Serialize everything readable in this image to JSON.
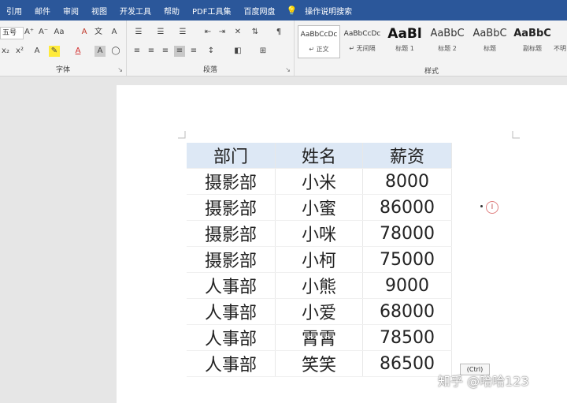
{
  "menubar": {
    "items": [
      "引用",
      "邮件",
      "审阅",
      "视图",
      "开发工具",
      "帮助",
      "PDF工具集",
      "百度网盘"
    ],
    "tell_me": "操作说明搜索"
  },
  "ribbon": {
    "font_group": {
      "label": "字体",
      "font_size": "五号"
    },
    "paragraph_group": {
      "label": "段落"
    },
    "styles_group": {
      "label": "样式",
      "items": [
        {
          "preview": "AaBbCcDc",
          "name": "↵ 正文"
        },
        {
          "preview": "AaBbCcDc",
          "name": "↵ 无间隔"
        },
        {
          "preview": "AaBl",
          "name": "标题 1"
        },
        {
          "preview": "AaBbC",
          "name": "标题 2"
        },
        {
          "preview": "AaBbC",
          "name": "标题"
        },
        {
          "preview": "AaBbC",
          "name": "副标题"
        },
        {
          "preview": "",
          "name": "不明"
        }
      ]
    }
  },
  "table": {
    "headers": [
      "部门",
      "姓名",
      "薪资"
    ],
    "rows": [
      [
        "摄影部",
        "小米",
        "8000"
      ],
      [
        "摄影部",
        "小蜜",
        "86000"
      ],
      [
        "摄影部",
        "小咪",
        "78000"
      ],
      [
        "摄影部",
        "小柯",
        "75000"
      ],
      [
        "人事部",
        "小熊",
        "9000"
      ],
      [
        "人事部",
        "小爱",
        "68000"
      ],
      [
        "人事部",
        "霄霄",
        "78500"
      ],
      [
        "人事部",
        "笑笑",
        "86500"
      ]
    ]
  },
  "paste_options": "(Ctrl)",
  "watermark": "知乎 @哈哈123"
}
